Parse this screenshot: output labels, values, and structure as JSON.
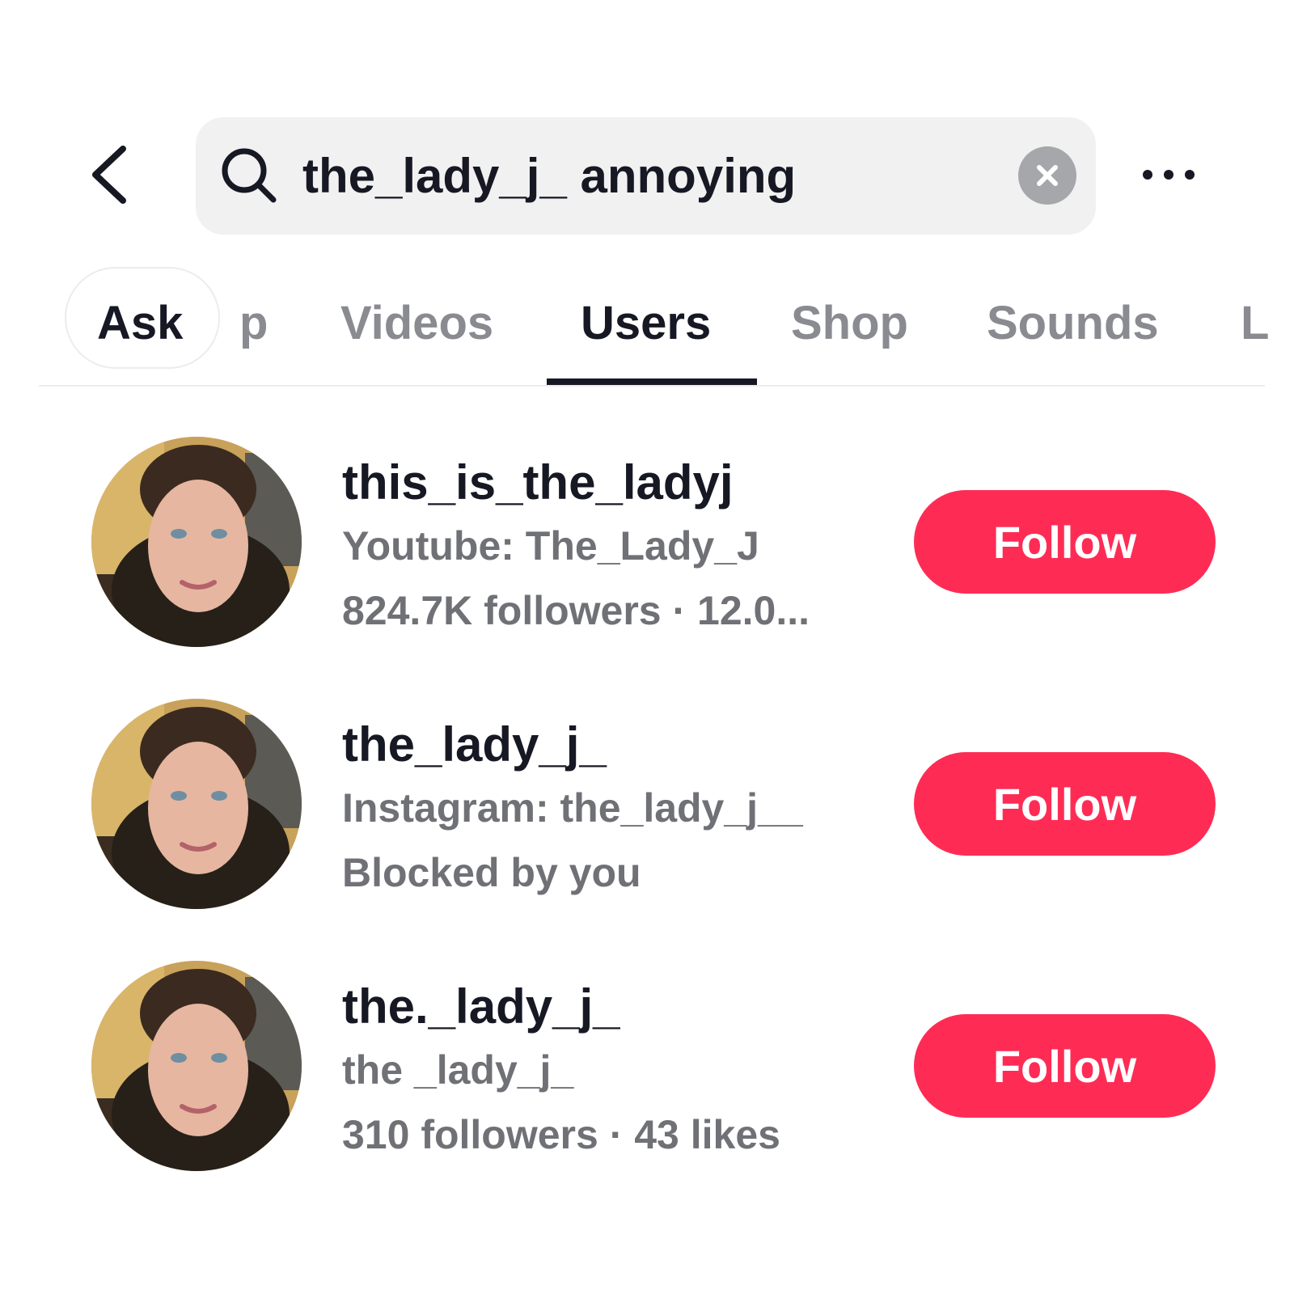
{
  "search": {
    "query": "the_lady_j_ annoying"
  },
  "tabs": [
    {
      "label": "Ask"
    },
    {
      "label": "p"
    },
    {
      "label": "Videos"
    },
    {
      "label": "Users"
    },
    {
      "label": "Shop"
    },
    {
      "label": "Sounds"
    },
    {
      "label": "L"
    }
  ],
  "active_tab": "Users",
  "users": [
    {
      "username": "this_is_the_ladyj",
      "line1": "Youtube: The_Lady_J",
      "line2": "824.7K followers · 12.0...",
      "follow_label": "Follow"
    },
    {
      "username": "the_lady_j_",
      "line1": "Instagram: the_lady_j__",
      "line2": "Blocked by you",
      "follow_label": "Follow"
    },
    {
      "username": "the._lady_j_",
      "line1": "the _lady_j_",
      "line2": "310 followers · 43 likes",
      "follow_label": "Follow"
    }
  ],
  "colors": {
    "accent": "#fe2c55",
    "text_primary": "#161823",
    "text_secondary": "#707176",
    "search_bg": "#f1f1f2"
  },
  "icons": [
    "back-arrow-icon",
    "search-icon",
    "clear-icon",
    "more-icon"
  ]
}
